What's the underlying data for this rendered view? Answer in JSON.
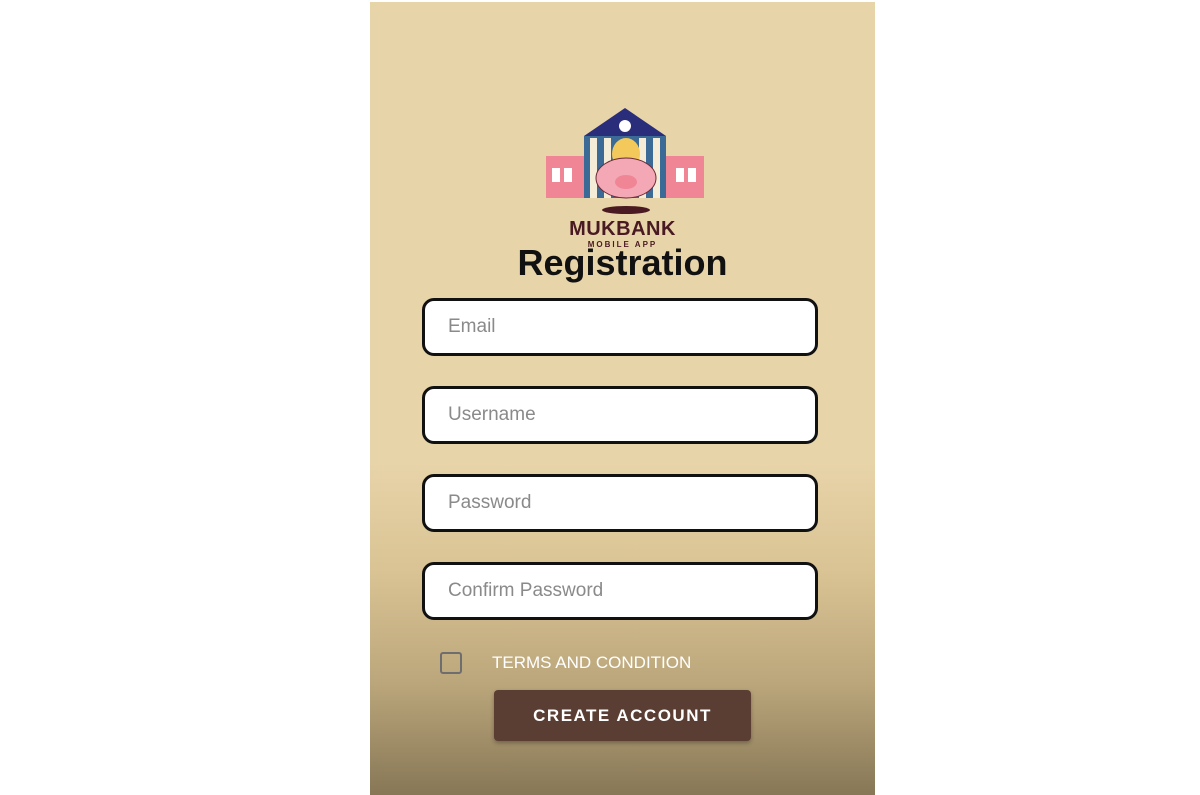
{
  "brand": {
    "name": "MUKBANK",
    "subtitle": "MOBILE APP"
  },
  "page_title": "Registration",
  "form": {
    "email_placeholder": "Email",
    "username_placeholder": "Username",
    "password_placeholder": "Password",
    "confirm_password_placeholder": "Confirm Password",
    "terms_label": "TERMS AND CONDITION",
    "terms_checked": false,
    "submit_label": "CREATE ACCOUNT"
  },
  "colors": {
    "background": "#e8d4a9",
    "button": "#5b3e33",
    "brand_text": "#4a1a22"
  }
}
